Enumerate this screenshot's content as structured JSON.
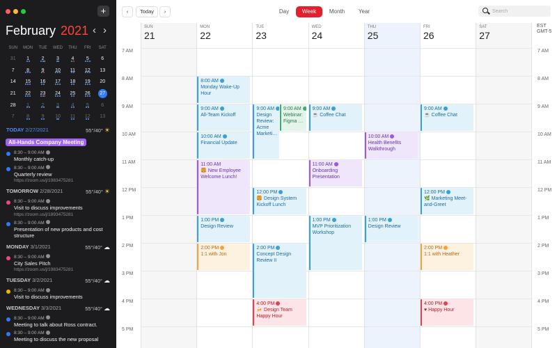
{
  "sidebar": {
    "add_label": "+",
    "month_name": "February",
    "year": "2021",
    "prev_label": "‹",
    "next_label": "›",
    "weekday_heads": [
      "SUN",
      "MON",
      "TUE",
      "WED",
      "THU",
      "FRI",
      "SAT"
    ],
    "mini_calendar": [
      [
        {
          "d": "31",
          "other": true
        },
        {
          "d": "1",
          "dots": [
            "#5b9cf5",
            "#5b9cf5"
          ]
        },
        {
          "d": "2",
          "dots": [
            "#5b9cf5",
            "#5b9cf5",
            "#5b9cf5"
          ]
        },
        {
          "d": "3",
          "dots": [
            "#5b9cf5",
            "#5b9cf5"
          ]
        },
        {
          "d": "4",
          "dots": [
            "#5b9cf5",
            "#e5414f"
          ]
        },
        {
          "d": "5",
          "dots": [
            "#5b9cf5",
            "#5b9cf5",
            "#5b9cf5"
          ]
        },
        {
          "d": "6"
        }
      ],
      [
        {
          "d": "7"
        },
        {
          "d": "8",
          "dots": [
            "#5b9cf5",
            "#5b9cf5",
            "#5b9cf5"
          ]
        },
        {
          "d": "9",
          "dots": [
            "#5b9cf5",
            "#e5414f"
          ]
        },
        {
          "d": "10",
          "dots": [
            "#5b9cf5",
            "#5b9cf5",
            "#5b9cf5"
          ]
        },
        {
          "d": "11",
          "dots": [
            "#5b9cf5",
            "#5b9cf5"
          ]
        },
        {
          "d": "12",
          "dots": [
            "#5b9cf5",
            "#5b9cf5",
            "#5b9cf5"
          ]
        },
        {
          "d": "13"
        }
      ],
      [
        {
          "d": "14"
        },
        {
          "d": "15",
          "dots": [
            "#5b9cf5",
            "#5b9cf5",
            "#5b9cf5"
          ]
        },
        {
          "d": "16",
          "dots": [
            "#5b9cf5",
            "#5b9cf5"
          ]
        },
        {
          "d": "17",
          "dots": [
            "#5b9cf5",
            "#5b9cf5",
            "#5b9cf5"
          ]
        },
        {
          "d": "18",
          "dots": [
            "#5b9cf5",
            "#5b9cf5"
          ]
        },
        {
          "d": "19",
          "dots": [
            "#5b9cf5",
            "#5b9cf5",
            "#5b9cf5"
          ]
        },
        {
          "d": "20"
        }
      ],
      [
        {
          "d": "21"
        },
        {
          "d": "22",
          "dots": [
            "#5b9cf5",
            "#5b9cf5",
            "#5b9cf5"
          ]
        },
        {
          "d": "23",
          "dots": [
            "#5b9cf5",
            "#5b9cf5",
            "#e5414f"
          ]
        },
        {
          "d": "24",
          "dots": [
            "#5b9cf5",
            "#5b9cf5",
            "#5b9cf5"
          ]
        },
        {
          "d": "25",
          "dots": [
            "#5b9cf5",
            "#5b9cf5"
          ]
        },
        {
          "d": "26",
          "dots": [
            "#5b9cf5",
            "#5b9cf5",
            "#5b9cf5"
          ]
        },
        {
          "d": "27",
          "today": true,
          "dots": [
            "#a064f0"
          ]
        }
      ],
      [
        {
          "d": "28"
        },
        {
          "d": "1",
          "other": true,
          "dots": [
            "#5b9cf5",
            "#5b9cf5"
          ]
        },
        {
          "d": "2",
          "other": true,
          "dots": [
            "#5b9cf5",
            "#5b9cf5"
          ]
        },
        {
          "d": "3",
          "other": true,
          "dots": [
            "#5b9cf5",
            "#5b9cf5"
          ]
        },
        {
          "d": "4",
          "other": true,
          "dots": [
            "#5b9cf5",
            "#5b9cf5"
          ]
        },
        {
          "d": "5",
          "other": true,
          "dots": [
            "#5b9cf5",
            "#5b9cf5"
          ]
        },
        {
          "d": "6",
          "other": true
        }
      ],
      [
        {
          "d": "7",
          "other": true
        },
        {
          "d": "8",
          "other": true,
          "dots": [
            "#5b9cf5",
            "#5b9cf5"
          ]
        },
        {
          "d": "9",
          "other": true,
          "dots": [
            "#5b9cf5",
            "#5b9cf5"
          ]
        },
        {
          "d": "10",
          "other": true,
          "dots": [
            "#5b9cf5",
            "#5b9cf5"
          ]
        },
        {
          "d": "11",
          "other": true,
          "dots": [
            "#5b9cf5",
            "#5b9cf5"
          ]
        },
        {
          "d": "12",
          "other": true,
          "dots": [
            "#5b9cf5",
            "#5b9cf5"
          ]
        },
        {
          "d": "13",
          "other": true
        }
      ]
    ],
    "agenda": [
      {
        "label": "TODAY",
        "date": "2/27/2021",
        "temp": "55°/40°",
        "weather": "sun",
        "is_today": true,
        "allday": "All-Hands Company Meeting",
        "events": [
          {
            "time": "8:30 – 9:00 AM",
            "title": "Monthly catch-up",
            "color": "#2f7cf6",
            "video": true
          },
          {
            "time": "8:30 – 9:00 AM",
            "title": "Quarterly review",
            "link": "https://zoom.us/j/1983475281",
            "color": "#2f7cf6",
            "video": true
          }
        ]
      },
      {
        "label": "TOMORROW",
        "date": "2/28/2021",
        "temp": "55°/40°",
        "weather": "sun",
        "events": [
          {
            "time": "8:30 – 9:00 AM",
            "title": "Visit to discuss improvements",
            "link": "https://zoom.us/j/1893475281",
            "color": "#e84a8a",
            "video": true
          },
          {
            "time": "8:30 – 9:00 AM",
            "title": "Presentation of new products and cost structure",
            "color": "#2f7cf6",
            "video": true
          }
        ]
      },
      {
        "label": "MONDAY",
        "date": "3/1/2021",
        "temp": "55°/40°",
        "weather": "cloud",
        "events": [
          {
            "time": "8:30 – 9:00 AM",
            "title": "City Sales Pitch",
            "link": "https://zoom.us/j/1983475281",
            "color": "#e84a8a",
            "video": true
          }
        ]
      },
      {
        "label": "TUESDAY",
        "date": "3/2/2021",
        "temp": "55°/40°",
        "weather": "cloud",
        "events": [
          {
            "time": "8:30 – 9:00 AM",
            "title": "Visit to discuss improvements",
            "color": "#f5b400",
            "video": true
          }
        ]
      },
      {
        "label": "WEDNESDAY",
        "date": "3/3/2021",
        "temp": "55°/40°",
        "weather": "cloud",
        "events": [
          {
            "time": "8:30 – 9:00 AM",
            "title": "Meeting to talk about Ross contract.",
            "color": "#2f7cf6",
            "video": true
          },
          {
            "time": "8:30 – 9:00 AM",
            "title": "Meeting to discuss the new proposal",
            "color": "#2f7cf6",
            "video": true
          }
        ]
      }
    ]
  },
  "toolbar": {
    "prev_label": "‹",
    "today_label": "Today",
    "next_label": "›",
    "tabs": {
      "day": "Day",
      "week": "Week",
      "month": "Month",
      "year": "Year"
    },
    "active_tab": "week",
    "search_placeholder": "Search"
  },
  "week": {
    "timezone": [
      "EST",
      "GMT-5"
    ],
    "hours": [
      "7 AM",
      "8 AM",
      "9 AM",
      "10 AM",
      "11 AM",
      "12 PM",
      "1 PM",
      "2 PM",
      "3 PM",
      "4 PM",
      "5 PM"
    ],
    "days": [
      {
        "dow": "SUN",
        "num": "21",
        "kind": "weekend"
      },
      {
        "dow": "MON",
        "num": "22",
        "kind": "weekday"
      },
      {
        "dow": "TUE",
        "num": "23",
        "kind": "weekday"
      },
      {
        "dow": "WED",
        "num": "24",
        "kind": "weekday"
      },
      {
        "dow": "THU",
        "num": "25",
        "kind": "today"
      },
      {
        "dow": "FRI",
        "num": "26",
        "kind": "weekday"
      },
      {
        "dow": "SAT",
        "num": "27",
        "kind": "weekend"
      }
    ],
    "events": [
      {
        "day": 1,
        "start": 8,
        "end": 9,
        "time": "8:00 AM",
        "title": "Monday Wake-Up Hour",
        "color": "blue",
        "video": true
      },
      {
        "day": 1,
        "start": 9,
        "end": 10,
        "time": "9:00 AM",
        "title": "All-Team Kickoff",
        "color": "blue",
        "video": true
      },
      {
        "day": 1,
        "start": 10,
        "end": 11,
        "time": "10:00 AM",
        "title": "Financial Update",
        "color": "blue",
        "video": true
      },
      {
        "day": 1,
        "start": 11,
        "end": 13,
        "time": "11:00 AM",
        "title": "🍔 New Employee Welcome Lunch!",
        "color": "purple",
        "video": false
      },
      {
        "day": 1,
        "start": 13,
        "end": 14,
        "time": "1:00 PM",
        "title": "Design Review",
        "color": "blue",
        "video": true
      },
      {
        "day": 1,
        "start": 14,
        "end": 15,
        "time": "2:00 PM",
        "title": "1:1 with Jon",
        "color": "orange",
        "video": true
      },
      {
        "day": 2,
        "start": 9,
        "end": 11,
        "time": "9:00 AM",
        "title": "Design Review: Acme Marketi…",
        "color": "blue",
        "video": true,
        "lane": 0,
        "lanes": 2
      },
      {
        "day": 2,
        "start": 9,
        "end": 10,
        "time": "9:00 AM",
        "title": "Webinar: Figma …",
        "color": "green",
        "video": true,
        "lane": 1,
        "lanes": 2
      },
      {
        "day": 2,
        "start": 12,
        "end": 13,
        "time": "12:00 PM",
        "title": "🍔 Design System Kickoff Lunch",
        "color": "blue",
        "video": true
      },
      {
        "day": 2,
        "start": 14,
        "end": 16,
        "time": "2:00 PM",
        "title": "Concept Design Review II",
        "color": "blue",
        "video": true
      },
      {
        "day": 2,
        "start": 16,
        "end": 17,
        "time": "4:00 PM",
        "title": "🍻 Design Team Happy Hour",
        "color": "red",
        "video": true
      },
      {
        "day": 3,
        "start": 9,
        "end": 10,
        "time": "9:00 AM",
        "title": "☕ Coffee Chat",
        "color": "blue",
        "video": true
      },
      {
        "day": 3,
        "start": 11,
        "end": 12,
        "time": "11:00 AM",
        "title": "Onboarding Presentation",
        "color": "purple",
        "video": true
      },
      {
        "day": 3,
        "start": 13,
        "end": 15,
        "time": "1:00 PM",
        "title": "MVP Prioritization Workshop",
        "color": "blue",
        "video": true
      },
      {
        "day": 4,
        "start": 10,
        "end": 11,
        "time": "10:00 AM",
        "title": "Health Benefits Walkthrough",
        "color": "purple",
        "video": true
      },
      {
        "day": 4,
        "start": 13,
        "end": 14,
        "time": "1:00 PM",
        "title": "Design Review",
        "color": "blue",
        "video": true
      },
      {
        "day": 5,
        "start": 9,
        "end": 10,
        "time": "9:00 AM",
        "title": "☕ Coffee Chat",
        "color": "blue",
        "video": true
      },
      {
        "day": 5,
        "start": 12,
        "end": 13,
        "time": "12:00 PM",
        "title": "🌿 Marketing Meet-and-Greet",
        "color": "blue",
        "video": true
      },
      {
        "day": 5,
        "start": 14,
        "end": 15,
        "time": "2:00 PM",
        "title": "1:1 with Heather",
        "color": "orange",
        "video": true
      },
      {
        "day": 5,
        "start": 16,
        "end": 17,
        "time": "4:00 PM",
        "title": "♥ Happy Hour",
        "color": "red",
        "video": true
      }
    ]
  }
}
